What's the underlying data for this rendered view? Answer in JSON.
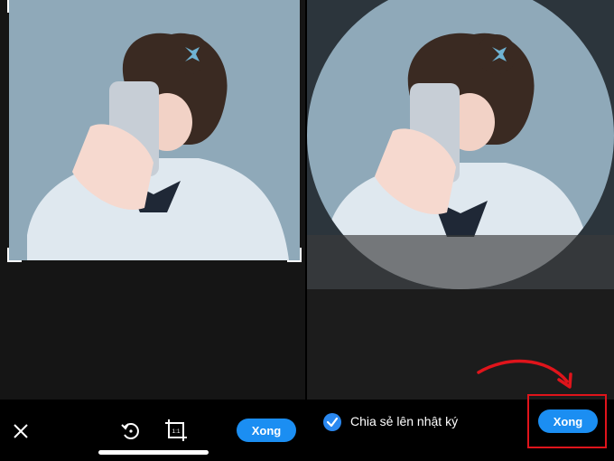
{
  "left_panel": {
    "toolbar": {
      "close_icon": "close-icon",
      "rotate_icon": "rotate-icon",
      "crop_icon": "crop-ratio-icon",
      "crop_ratio_label": "1:1",
      "done_label": "Xong"
    }
  },
  "right_panel": {
    "share_to_diary_label": "Chia sẻ lên nhật ký",
    "share_to_diary_checked": true,
    "done_label": "Xong"
  },
  "colors": {
    "accent_blue": "#1b8ef2",
    "highlight_red": "#e0141b",
    "toolbar_bg": "#000000"
  }
}
